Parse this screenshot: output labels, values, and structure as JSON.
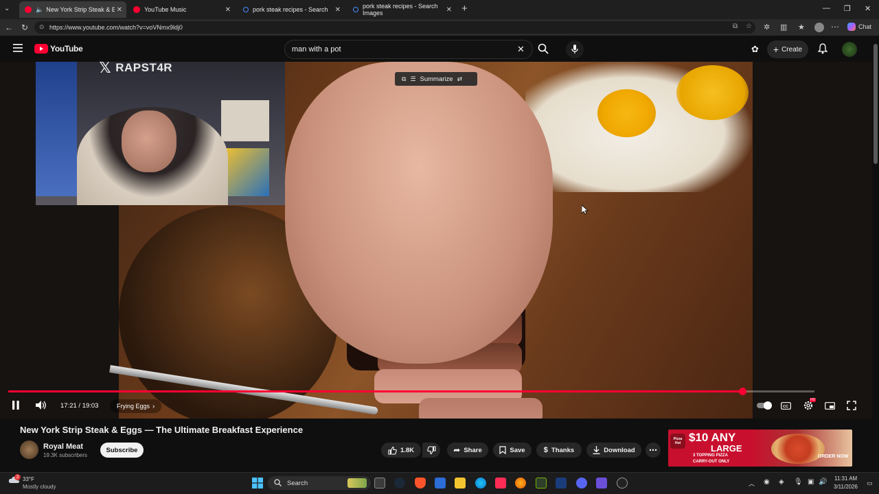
{
  "browser": {
    "tabs": [
      {
        "title": "New York Strip Steak & Eggs",
        "active": true,
        "icon_color": "#ff0033"
      },
      {
        "title": "YouTube Music",
        "active": false,
        "icon_color": "#ff0033"
      },
      {
        "title": "pork steak recipes - Search",
        "active": false,
        "icon_color": "#4a8cff"
      },
      {
        "title": "pork steak recipes - Search Images",
        "active": false,
        "icon_color": "#4a8cff"
      }
    ],
    "url": "https://www.youtube.com/watch?v=voVNmx9ldj0",
    "chat_label": "Chat"
  },
  "youtube": {
    "logo_text": "YouTube",
    "search_query": "man with a pot",
    "create_label": "Create"
  },
  "player": {
    "overlay_handle": "RAPST4R",
    "summarize_label": "Summarize",
    "time_display": "17:21 / 19:03",
    "progress": 0.9108,
    "chapter": "Frying Eggs",
    "accent_color": "#ff0033"
  },
  "video_info": {
    "title": "New York Strip Steak & Eggs — The Ultimate Breakfast Experience",
    "channel": "Royal Meat",
    "subscribers": "19.3K subscribers",
    "subscribe_label": "Subscribe",
    "likes": "1.8K",
    "share_label": "Share",
    "save_label": "Save",
    "thanks_label": "Thanks",
    "download_label": "Download"
  },
  "ad": {
    "headline": "$10 ANY",
    "headline2": "LARGE",
    "subline": "3 TOPPING PIZZA",
    "subline2": "CARRY-OUT ONLY",
    "cta": "ORDER NOW",
    "brand": "Pizza Hut"
  },
  "taskbar": {
    "weather_temp": "33°F",
    "weather_desc": "Mostly cloudy",
    "weather_badge": "2",
    "search_placeholder": "Search",
    "time": "11:31 AM",
    "date": "3/11/2026"
  }
}
